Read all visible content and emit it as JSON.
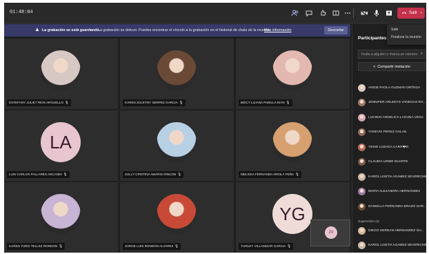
{
  "topbar": {
    "timer": "01:48:04",
    "icons": [
      "participants-icon",
      "chat-icon",
      "reactions-icon",
      "rooms-icon",
      "more-icon",
      "camera-off-icon",
      "mic-icon",
      "share-icon"
    ],
    "leave_label": "Salir"
  },
  "dropdown": {
    "items": [
      "Salir",
      "Finalizar la reunión"
    ]
  },
  "banner": {
    "bold_text": "La grabación se está guardando.",
    "text": "La grabación se detuvo. Puedes encontrar el vínculo a la grabación en el historial de chats de la reunión.",
    "link": "Más información",
    "dismiss_label": "Descartar"
  },
  "tiles": [
    {
      "name": "ESTEFANY JULIET RIOS ARGUELLO",
      "avatar": "photo",
      "color": "#d8c8c4"
    },
    {
      "name": "KAREN ZULEYNY SERPEZ GARCIA",
      "avatar": "photo",
      "color": "#6a4a36"
    },
    {
      "name": "BEICY LILIANA PADILLA DIAN",
      "avatar": "photo",
      "color": "#e2b8b0"
    },
    {
      "name": "LUIS CARLOS PALLARES ASCANIO",
      "avatar": "initials",
      "initials": "LA",
      "color": "#e8c6cf"
    },
    {
      "name": "ZULLY CRISTINA AMARIS RINCON",
      "avatar": "photo",
      "color": "#b8d0e4"
    },
    {
      "name": "MELISSA FERNANDA ARDILA PEÑA",
      "avatar": "photo",
      "color": "#d6a070"
    },
    {
      "name": "KAREN YIZED TELLEZ RONDON",
      "avatar": "photo",
      "color": "#c8b4d4"
    },
    {
      "name": "JORGE LUIS RONDON ALVAREZ",
      "avatar": "photo",
      "color": "#c84a36"
    },
    {
      "name": "YURLEY VILLAMIZAR GARCIA",
      "avatar": "initials",
      "initials": "YG",
      "color": "#efdcd8"
    }
  ],
  "self_view": {
    "initials": "JV"
  },
  "panel": {
    "title": "Participantes",
    "invite_placeholder": "Invita a alguien o marca un número",
    "share_label": "Compartir invitación",
    "section_label": "Supervisión (2)",
    "participants": [
      {
        "name": "ANGIE PAOLA GUZMAN ORTEGA",
        "color": "#d8c8c4"
      },
      {
        "name": "JENNIFER ARLEDYS VANEGAS RO...",
        "color": "#9a7a6a"
      },
      {
        "name": "LUCINIO ANGELICA LAGUNA VEGA",
        "color": "#d4a6b4"
      },
      {
        "name": "YANEVIS PEREZ GALAN",
        "color": "#8a6a5a"
      },
      {
        "name": "YESID LOZADA CARR�O",
        "color": "#b46a5a"
      },
      {
        "name": "CLAUDIA URIBE DUARTE",
        "color": "#7a5a4a"
      },
      {
        "name": "KAROL LISETH AGAMEZ SEVERICHE",
        "color": "#c8b8a8"
      },
      {
        "name": "MARIA ALEJANDRA HERNANDEZ",
        "color": "#9a7aa4"
      },
      {
        "name": "DANIELLA FERNANDA ERAZO GAR...",
        "color": "#6a4a3a"
      }
    ],
    "supervisors": [
      {
        "name": "DIEGO HERNAN HERNANDEZ GU...",
        "color": "#d4b89a"
      },
      {
        "name": "KAROL LISETH AGAMEZ SEVERICHE",
        "color": "#c8b8a8"
      }
    ]
  }
}
